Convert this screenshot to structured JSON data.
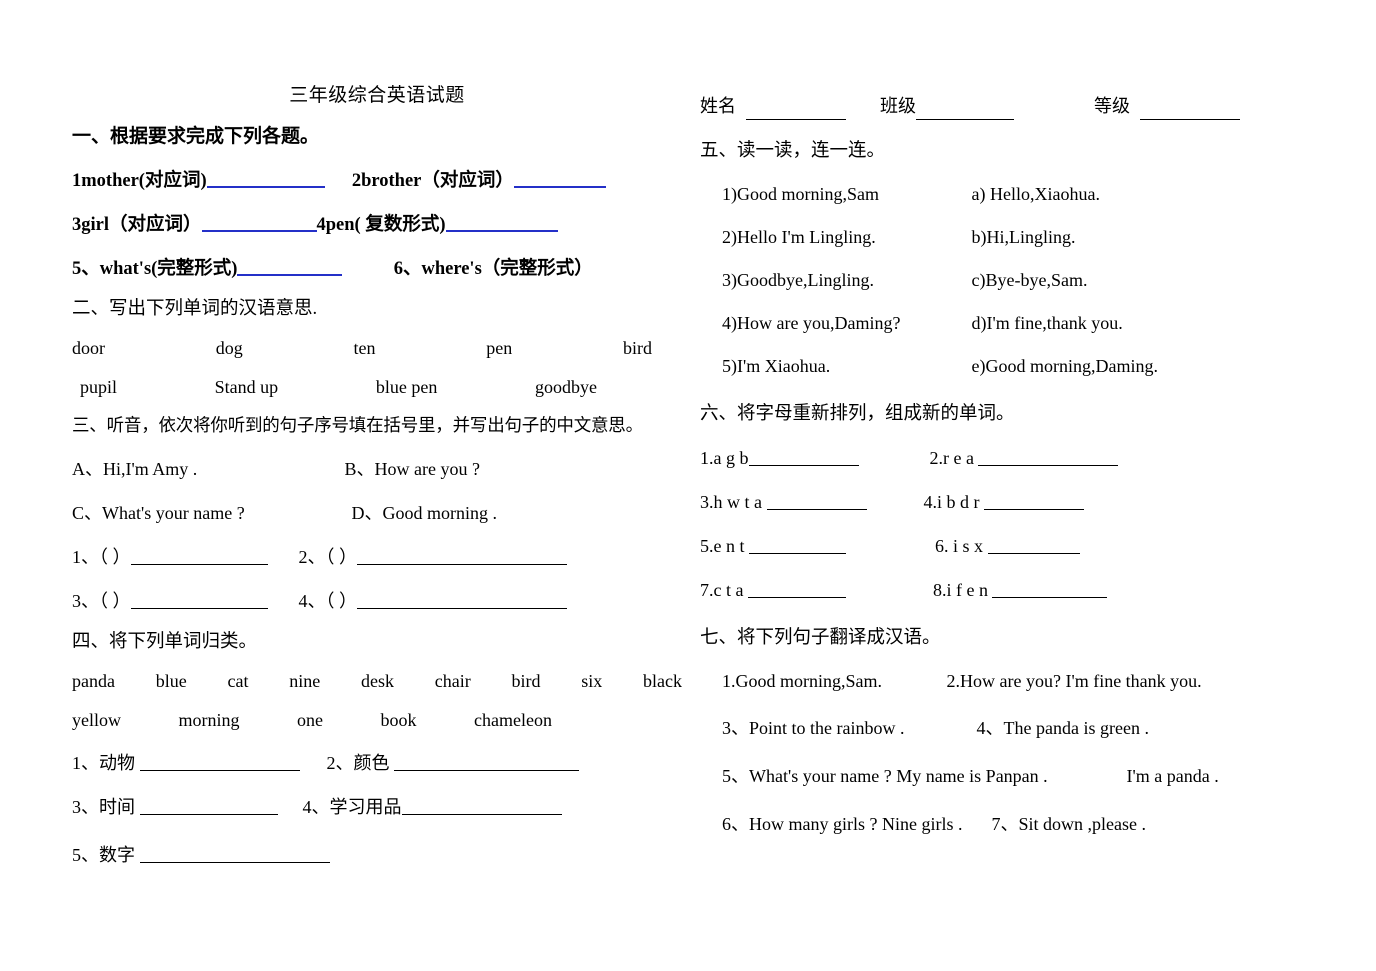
{
  "document": {
    "title": "三年级综合英语试题"
  },
  "header": {
    "name_label": "姓名",
    "class_label": "班级",
    "grade_label": "等级"
  },
  "section1": {
    "heading": "一、根据要求完成下列各题。",
    "items": [
      {
        "text": "1mother(对应词)",
        "blank": true
      },
      {
        "text": "2brother（对应词）",
        "blank": true
      },
      {
        "text": "3girl（对应词）",
        "blank": true
      },
      {
        "text": "4pen( 复数形式)",
        "blank": true
      },
      {
        "text": "5、what's(完整形式)",
        "blank": true
      },
      {
        "text": "6、where's（完整形式）",
        "blank": false
      }
    ]
  },
  "section2": {
    "heading": "二、写出下列单词的汉语意思.",
    "row1": [
      "door",
      "dog",
      "ten",
      "pen",
      "bird"
    ],
    "row2": [
      "pupil",
      "Stand up",
      "blue pen",
      "goodbye"
    ]
  },
  "section3": {
    "heading": "三、听音，依次将你听到的句子序号填在括号里，并写出句子的中文意思。",
    "options": [
      "A、Hi,I'm Amy .",
      "B、How are you ?",
      "C、What's your name ?",
      "D、Good morning ."
    ],
    "answers": [
      "1、（      ）",
      "2、（      ）",
      "3、（      ）",
      "4、（      ）"
    ]
  },
  "section4": {
    "heading": "四、将下列单词归类。",
    "words_row1": [
      "panda",
      "blue",
      "cat",
      "nine",
      "desk",
      "chair",
      "bird",
      "six",
      "black"
    ],
    "words_row2": [
      "yellow",
      "morning",
      "one",
      "book",
      "chameleon"
    ],
    "categories": [
      "1、动物",
      "2、颜色",
      "3、时间",
      "4、学习用品",
      "5、数字"
    ]
  },
  "section5": {
    "heading": "五、读一读，连一连。",
    "left": [
      "1)Good morning,Sam",
      "2)Hello I'm Lingling.",
      "3)Goodbye,Lingling.",
      "4)How are you,Daming?",
      "5)I'm Xiaohua."
    ],
    "right": [
      "a) Hello,Xiaohua.",
      "b)Hi,Lingling.",
      "c)Bye-bye,Sam.",
      "d)I'm fine,thank you.",
      "e)Good morning,Daming."
    ]
  },
  "section6": {
    "heading": "六、将字母重新排列，组成新的单词。",
    "items": [
      "1.a g b",
      "2.r e a",
      "3.h w t a",
      "4.i b d r",
      "5.e n t",
      "6. i s x",
      "7.c t a",
      "8.i f e n"
    ]
  },
  "section7": {
    "heading": "七、将下列句子翻译成汉语。",
    "lines": [
      {
        "a": "1.Good morning,Sam.",
        "b": "2.How are you?    I'm fine thank you."
      },
      {
        "a": "3、Point to the rainbow .",
        "b": "4、The panda is green ."
      },
      {
        "a": "5、What's your name ?   My name is Panpan .",
        "b": "I'm a panda ."
      },
      {
        "a": "6、How many girls ?   Nine girls .",
        "b": "7、Sit down ,please ."
      }
    ]
  },
  "colors": {
    "blank_blue": "#2430c8",
    "text": "#000000",
    "background": "#ffffff"
  }
}
